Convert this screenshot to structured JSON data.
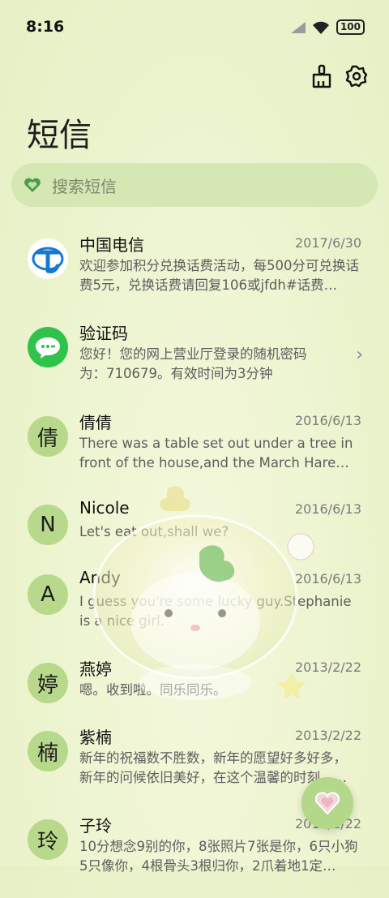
{
  "status": {
    "time": "8:16",
    "battery": "100"
  },
  "header": {
    "title": "短信"
  },
  "search": {
    "placeholder": "搜索短信"
  },
  "messages": [
    {
      "sender": "中国电信",
      "date": "2017/6/30",
      "preview": "欢迎参加积分兑换话费活动，每500分可兑换话费5元，兑换话费请回复106或jfdh#话费…"
    },
    {
      "sender": "验证码",
      "date": "",
      "preview": "您好！您的网上营业厅登录的随机密码为：710679。有效时间为3分钟"
    },
    {
      "sender": "倩倩",
      "avatar": "倩",
      "date": "2016/6/13",
      "preview": "There was a table set out under a tree in front of the house,and the March Hare an…"
    },
    {
      "sender": "Nicole",
      "avatar": "N",
      "date": "2016/6/13",
      "preview": "Let's eat out,shall we?"
    },
    {
      "sender": "Andy",
      "avatar": "A",
      "date": "2016/6/13",
      "preview": "I guess you're some lucky guy.Stephanie is a nice girl."
    },
    {
      "sender": "燕婷",
      "avatar": "婷",
      "date": "2013/2/22",
      "preview": "嗯。收到啦。同乐同乐。"
    },
    {
      "sender": "紫楠",
      "avatar": "楠",
      "date": "2013/2/22",
      "preview": "新年的祝福数不胜数，新年的愿望好多好多，新年的问候依旧美好，在这个温馨的时刻，…"
    },
    {
      "sender": "子玲",
      "avatar": "玲",
      "date": "2013/2/22",
      "preview": "10分想念9别的你，8张照片7张是你，6只小狗5只像你，4根骨头3根归你，2爪着地1定…"
    }
  ]
}
